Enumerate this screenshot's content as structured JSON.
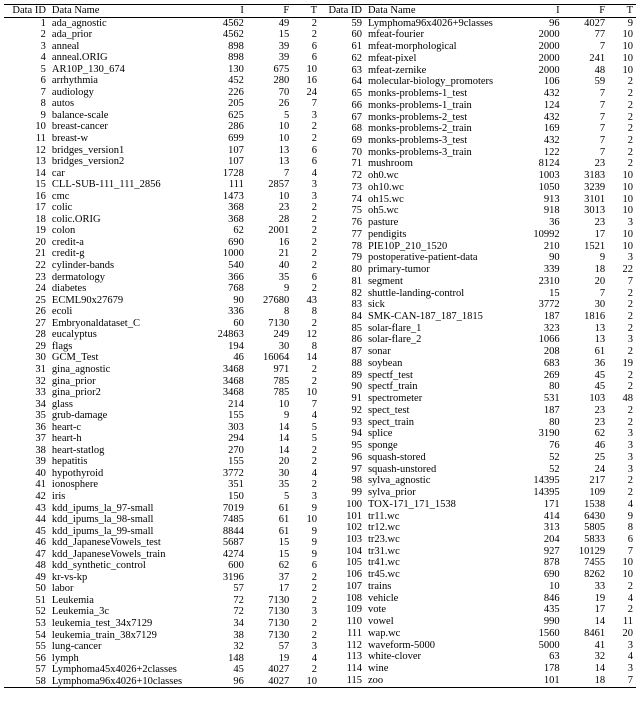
{
  "headers": {
    "id": "Data ID",
    "name": "Data Name",
    "I": "I",
    "F": "F",
    "T": "T"
  },
  "rows_left": [
    {
      "id": 1,
      "name": "ada_agnostic",
      "I": 4562,
      "F": 49,
      "T": 2
    },
    {
      "id": 2,
      "name": "ada_prior",
      "I": 4562,
      "F": 15,
      "T": 2
    },
    {
      "id": 3,
      "name": "anneal",
      "I": 898,
      "F": 39,
      "T": 6
    },
    {
      "id": 4,
      "name": "anneal.ORIG",
      "I": 898,
      "F": 39,
      "T": 6
    },
    {
      "id": 5,
      "name": "AR10P_130_674",
      "I": 130,
      "F": 675,
      "T": 10
    },
    {
      "id": 6,
      "name": "arrhythmia",
      "I": 452,
      "F": 280,
      "T": 16
    },
    {
      "id": 7,
      "name": "audiology",
      "I": 226,
      "F": 70,
      "T": 24
    },
    {
      "id": 8,
      "name": "autos",
      "I": 205,
      "F": 26,
      "T": 7
    },
    {
      "id": 9,
      "name": "balance-scale",
      "I": 625,
      "F": 5,
      "T": 3
    },
    {
      "id": 10,
      "name": "breast-cancer",
      "I": 286,
      "F": 10,
      "T": 2
    },
    {
      "id": 11,
      "name": "breast-w",
      "I": 699,
      "F": 10,
      "T": 2
    },
    {
      "id": 12,
      "name": "bridges_version1",
      "I": 107,
      "F": 13,
      "T": 6
    },
    {
      "id": 13,
      "name": "bridges_version2",
      "I": 107,
      "F": 13,
      "T": 6
    },
    {
      "id": 14,
      "name": "car",
      "I": 1728,
      "F": 7,
      "T": 4
    },
    {
      "id": 15,
      "name": "CLL-SUB-111_111_2856",
      "I": 111,
      "F": 2857,
      "T": 3
    },
    {
      "id": 16,
      "name": "cmc",
      "I": 1473,
      "F": 10,
      "T": 3
    },
    {
      "id": 17,
      "name": "colic",
      "I": 368,
      "F": 23,
      "T": 2
    },
    {
      "id": 18,
      "name": "colic.ORIG",
      "I": 368,
      "F": 28,
      "T": 2
    },
    {
      "id": 19,
      "name": "colon",
      "I": 62,
      "F": 2001,
      "T": 2
    },
    {
      "id": 20,
      "name": "credit-a",
      "I": 690,
      "F": 16,
      "T": 2
    },
    {
      "id": 21,
      "name": "credit-g",
      "I": 1000,
      "F": 21,
      "T": 2
    },
    {
      "id": 22,
      "name": "cylinder-bands",
      "I": 540,
      "F": 40,
      "T": 2
    },
    {
      "id": 23,
      "name": "dermatology",
      "I": 366,
      "F": 35,
      "T": 6
    },
    {
      "id": 24,
      "name": "diabetes",
      "I": 768,
      "F": 9,
      "T": 2
    },
    {
      "id": 25,
      "name": "ECML90x27679",
      "I": 90,
      "F": 27680,
      "T": 43
    },
    {
      "id": 26,
      "name": "ecoli",
      "I": 336,
      "F": 8,
      "T": 8
    },
    {
      "id": 27,
      "name": "Embryonaldataset_C",
      "I": 60,
      "F": 7130,
      "T": 2
    },
    {
      "id": 28,
      "name": "eucalyptus",
      "I": 24863,
      "F": 249,
      "T": 12
    },
    {
      "id": 29,
      "name": "flags",
      "I": 194,
      "F": 30,
      "T": 8
    },
    {
      "id": 30,
      "name": "GCM_Test",
      "I": 46,
      "F": 16064,
      "T": 14
    },
    {
      "id": 31,
      "name": "gina_agnostic",
      "I": 3468,
      "F": 971,
      "T": 2
    },
    {
      "id": 32,
      "name": "gina_prior",
      "I": 3468,
      "F": 785,
      "T": 2
    },
    {
      "id": 33,
      "name": "gina_prior2",
      "I": 3468,
      "F": 785,
      "T": 10
    },
    {
      "id": 34,
      "name": "glass",
      "I": 214,
      "F": 10,
      "T": 7
    },
    {
      "id": 35,
      "name": "grub-damage",
      "I": 155,
      "F": 9,
      "T": 4
    },
    {
      "id": 36,
      "name": "heart-c",
      "I": 303,
      "F": 14,
      "T": 5
    },
    {
      "id": 37,
      "name": "heart-h",
      "I": 294,
      "F": 14,
      "T": 5
    },
    {
      "id": 38,
      "name": "heart-statlog",
      "I": 270,
      "F": 14,
      "T": 2
    },
    {
      "id": 39,
      "name": "hepatitis",
      "I": 155,
      "F": 20,
      "T": 2
    },
    {
      "id": 40,
      "name": "hypothyroid",
      "I": 3772,
      "F": 30,
      "T": 4
    },
    {
      "id": 41,
      "name": "ionosphere",
      "I": 351,
      "F": 35,
      "T": 2
    },
    {
      "id": 42,
      "name": "iris",
      "I": 150,
      "F": 5,
      "T": 3
    },
    {
      "id": 43,
      "name": "kdd_ipums_la_97-small",
      "I": 7019,
      "F": 61,
      "T": 9
    },
    {
      "id": 44,
      "name": "kdd_ipums_la_98-small",
      "I": 7485,
      "F": 61,
      "T": 10
    },
    {
      "id": 45,
      "name": "kdd_ipums_la_99-small",
      "I": 8844,
      "F": 61,
      "T": 9
    },
    {
      "id": 46,
      "name": "kdd_JapaneseVowels_test",
      "I": 5687,
      "F": 15,
      "T": 9
    },
    {
      "id": 47,
      "name": "kdd_JapaneseVowels_train",
      "I": 4274,
      "F": 15,
      "T": 9
    },
    {
      "id": 48,
      "name": "kdd_synthetic_control",
      "I": 600,
      "F": 62,
      "T": 6
    },
    {
      "id": 49,
      "name": "kr-vs-kp",
      "I": 3196,
      "F": 37,
      "T": 2
    },
    {
      "id": 50,
      "name": "labor",
      "I": 57,
      "F": 17,
      "T": 2
    },
    {
      "id": 51,
      "name": "Leukemia",
      "I": 72,
      "F": 7130,
      "T": 2
    },
    {
      "id": 52,
      "name": "Leukemia_3c",
      "I": 72,
      "F": 7130,
      "T": 3
    },
    {
      "id": 53,
      "name": "leukemia_test_34x7129",
      "I": 34,
      "F": 7130,
      "T": 2
    },
    {
      "id": 54,
      "name": "leukemia_train_38x7129",
      "I": 38,
      "F": 7130,
      "T": 2
    },
    {
      "id": 55,
      "name": "lung-cancer",
      "I": 32,
      "F": 57,
      "T": 3
    },
    {
      "id": 56,
      "name": "lymph",
      "I": 148,
      "F": 19,
      "T": 4
    },
    {
      "id": 57,
      "name": "Lymphoma45x4026+2classes",
      "I": 45,
      "F": 4027,
      "T": 2
    },
    {
      "id": 58,
      "name": "Lymphoma96x4026+10classes",
      "I": 96,
      "F": 4027,
      "T": 10
    }
  ],
  "rows_right": [
    {
      "id": 59,
      "name": "Lymphoma96x4026+9classes",
      "I": 96,
      "F": 4027,
      "T": 9
    },
    {
      "id": 60,
      "name": "mfeat-fourier",
      "I": 2000,
      "F": 77,
      "T": 10
    },
    {
      "id": 61,
      "name": "mfeat-morphological",
      "I": 2000,
      "F": 7,
      "T": 10
    },
    {
      "id": 62,
      "name": "mfeat-pixel",
      "I": 2000,
      "F": 241,
      "T": 10
    },
    {
      "id": 63,
      "name": "mfeat-zernike",
      "I": 2000,
      "F": 48,
      "T": 10
    },
    {
      "id": 64,
      "name": "molecular-biology_promoters",
      "I": 106,
      "F": 59,
      "T": 2
    },
    {
      "id": 65,
      "name": "monks-problems-1_test",
      "I": 432,
      "F": 7,
      "T": 2
    },
    {
      "id": 66,
      "name": "monks-problems-1_train",
      "I": 124,
      "F": 7,
      "T": 2
    },
    {
      "id": 67,
      "name": "monks-problems-2_test",
      "I": 432,
      "F": 7,
      "T": 2
    },
    {
      "id": 68,
      "name": "monks-problems-2_train",
      "I": 169,
      "F": 7,
      "T": 2
    },
    {
      "id": 69,
      "name": "monks-problems-3_test",
      "I": 432,
      "F": 7,
      "T": 2
    },
    {
      "id": 70,
      "name": "monks-problems-3_train",
      "I": 122,
      "F": 7,
      "T": 2
    },
    {
      "id": 71,
      "name": "mushroom",
      "I": 8124,
      "F": 23,
      "T": 2
    },
    {
      "id": 72,
      "name": "oh0.wc",
      "I": 1003,
      "F": 3183,
      "T": 10
    },
    {
      "id": 73,
      "name": "oh10.wc",
      "I": 1050,
      "F": 3239,
      "T": 10
    },
    {
      "id": 74,
      "name": "oh15.wc",
      "I": 913,
      "F": 3101,
      "T": 10
    },
    {
      "id": 75,
      "name": "oh5.wc",
      "I": 918,
      "F": 3013,
      "T": 10
    },
    {
      "id": 76,
      "name": "pasture",
      "I": 36,
      "F": 23,
      "T": 3
    },
    {
      "id": 77,
      "name": "pendigits",
      "I": 10992,
      "F": 17,
      "T": 10
    },
    {
      "id": 78,
      "name": "PIE10P_210_1520",
      "I": 210,
      "F": 1521,
      "T": 10
    },
    {
      "id": 79,
      "name": "postoperative-patient-data",
      "I": 90,
      "F": 9,
      "T": 3
    },
    {
      "id": 80,
      "name": "primary-tumor",
      "I": 339,
      "F": 18,
      "T": 22
    },
    {
      "id": 81,
      "name": "segment",
      "I": 2310,
      "F": 20,
      "T": 7
    },
    {
      "id": 82,
      "name": "shuttle-landing-control",
      "I": 15,
      "F": 7,
      "T": 2
    },
    {
      "id": 83,
      "name": "sick",
      "I": 3772,
      "F": 30,
      "T": 2
    },
    {
      "id": 84,
      "name": "SMK-CAN-187_187_1815",
      "I": 187,
      "F": 1816,
      "T": 2
    },
    {
      "id": 85,
      "name": "solar-flare_1",
      "I": 323,
      "F": 13,
      "T": 2
    },
    {
      "id": 86,
      "name": "solar-flare_2",
      "I": 1066,
      "F": 13,
      "T": 3
    },
    {
      "id": 87,
      "name": "sonar",
      "I": 208,
      "F": 61,
      "T": 2
    },
    {
      "id": 88,
      "name": "soybean",
      "I": 683,
      "F": 36,
      "T": 19
    },
    {
      "id": 89,
      "name": "spectf_test",
      "I": 269,
      "F": 45,
      "T": 2
    },
    {
      "id": 90,
      "name": "spectf_train",
      "I": 80,
      "F": 45,
      "T": 2
    },
    {
      "id": 91,
      "name": "spectrometer",
      "I": 531,
      "F": 103,
      "T": 48
    },
    {
      "id": 92,
      "name": "spect_test",
      "I": 187,
      "F": 23,
      "T": 2
    },
    {
      "id": 93,
      "name": "spect_train",
      "I": 80,
      "F": 23,
      "T": 2
    },
    {
      "id": 94,
      "name": "splice",
      "I": 3190,
      "F": 62,
      "T": 3
    },
    {
      "id": 95,
      "name": "sponge",
      "I": 76,
      "F": 46,
      "T": 3
    },
    {
      "id": 96,
      "name": "squash-stored",
      "I": 52,
      "F": 25,
      "T": 3
    },
    {
      "id": 97,
      "name": "squash-unstored",
      "I": 52,
      "F": 24,
      "T": 3
    },
    {
      "id": 98,
      "name": "sylva_agnostic",
      "I": 14395,
      "F": 217,
      "T": 2
    },
    {
      "id": 99,
      "name": "sylva_prior",
      "I": 14395,
      "F": 109,
      "T": 2
    },
    {
      "id": 100,
      "name": "TOX-171_171_1538",
      "I": 171,
      "F": 1538,
      "T": 4
    },
    {
      "id": 101,
      "name": "tr11.wc",
      "I": 414,
      "F": 6430,
      "T": 9
    },
    {
      "id": 102,
      "name": "tr12.wc",
      "I": 313,
      "F": 5805,
      "T": 8
    },
    {
      "id": 103,
      "name": "tr23.wc",
      "I": 204,
      "F": 5833,
      "T": 6
    },
    {
      "id": 104,
      "name": "tr31.wc",
      "I": 927,
      "F": 10129,
      "T": 7
    },
    {
      "id": 105,
      "name": "tr41.wc",
      "I": 878,
      "F": 7455,
      "T": 10
    },
    {
      "id": 106,
      "name": "tr45.wc",
      "I": 690,
      "F": 8262,
      "T": 10
    },
    {
      "id": 107,
      "name": "trains",
      "I": 10,
      "F": 33,
      "T": 2
    },
    {
      "id": 108,
      "name": "vehicle",
      "I": 846,
      "F": 19,
      "T": 4
    },
    {
      "id": 109,
      "name": "vote",
      "I": 435,
      "F": 17,
      "T": 2
    },
    {
      "id": 110,
      "name": "vowel",
      "I": 990,
      "F": 14,
      "T": 11
    },
    {
      "id": 111,
      "name": "wap.wc",
      "I": 1560,
      "F": 8461,
      "T": 20
    },
    {
      "id": 112,
      "name": "waveform-5000",
      "I": 5000,
      "F": 41,
      "T": 3
    },
    {
      "id": 113,
      "name": "white-clover",
      "I": 63,
      "F": 32,
      "T": 4
    },
    {
      "id": 114,
      "name": "wine",
      "I": 178,
      "F": 14,
      "T": 3
    },
    {
      "id": 115,
      "name": "zoo",
      "I": 101,
      "F": 18,
      "T": 7
    }
  ]
}
